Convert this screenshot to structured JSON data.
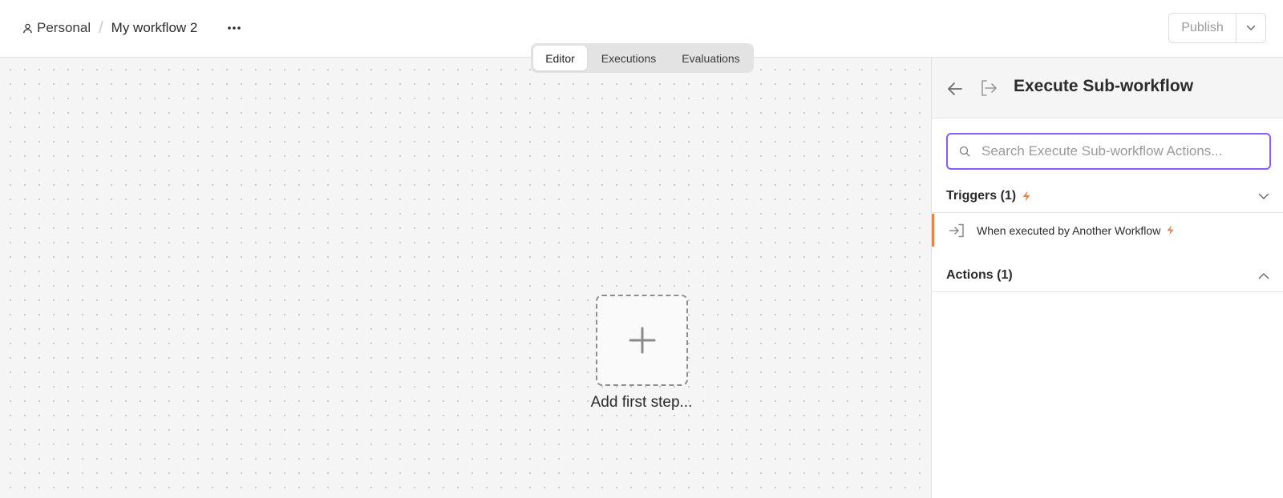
{
  "header": {
    "project_label": "Personal",
    "separator": "/",
    "workflow_name": "My workflow 2",
    "publish_label": "Publish"
  },
  "tabs": [
    {
      "label": "Editor",
      "active": true
    },
    {
      "label": "Executions",
      "active": false
    },
    {
      "label": "Evaluations",
      "active": false
    }
  ],
  "canvas": {
    "add_step_label": "Add first step..."
  },
  "panel": {
    "title": "Execute Sub-workflow",
    "search_placeholder": "Search Execute Sub-workflow Actions...",
    "search_value": "",
    "triggers": {
      "label": "Triggers (1)",
      "expanded": true,
      "items": [
        {
          "label": "When executed by Another Workflow",
          "icon": "log-in-icon",
          "selected": true
        }
      ]
    },
    "actions": {
      "label": "Actions (1)",
      "expanded": true
    }
  },
  "colors": {
    "accent_purple": "#8b5cf6",
    "trigger_orange": "#e8834a",
    "canvas_bg": "#f5f5f5"
  }
}
